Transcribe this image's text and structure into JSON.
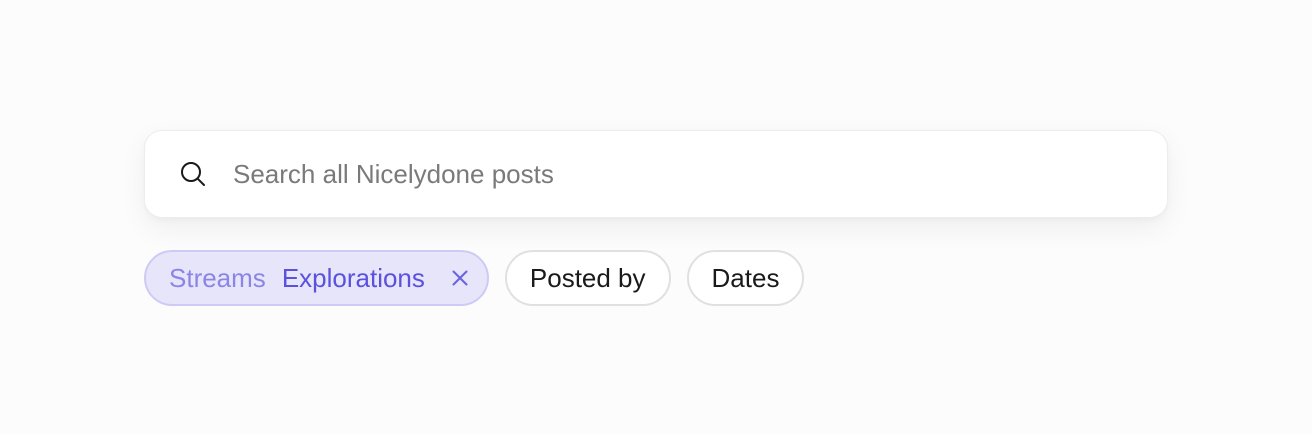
{
  "search": {
    "placeholder": "Search all Nicelydone posts",
    "value": "",
    "icon": "search-icon"
  },
  "filters": {
    "active": {
      "key": "Streams",
      "value": "Explorations",
      "remove_icon": "close-icon"
    },
    "posted_by_label": "Posted by",
    "dates_label": "Dates"
  },
  "colors": {
    "background": "#fcfcfc",
    "chip_active_bg": "#e6e5fa",
    "chip_active_border": "#cdcbf5",
    "chip_active_key": "#8b85e6",
    "chip_active_value": "#5b51de",
    "chip_border": "#e0e0e0"
  }
}
